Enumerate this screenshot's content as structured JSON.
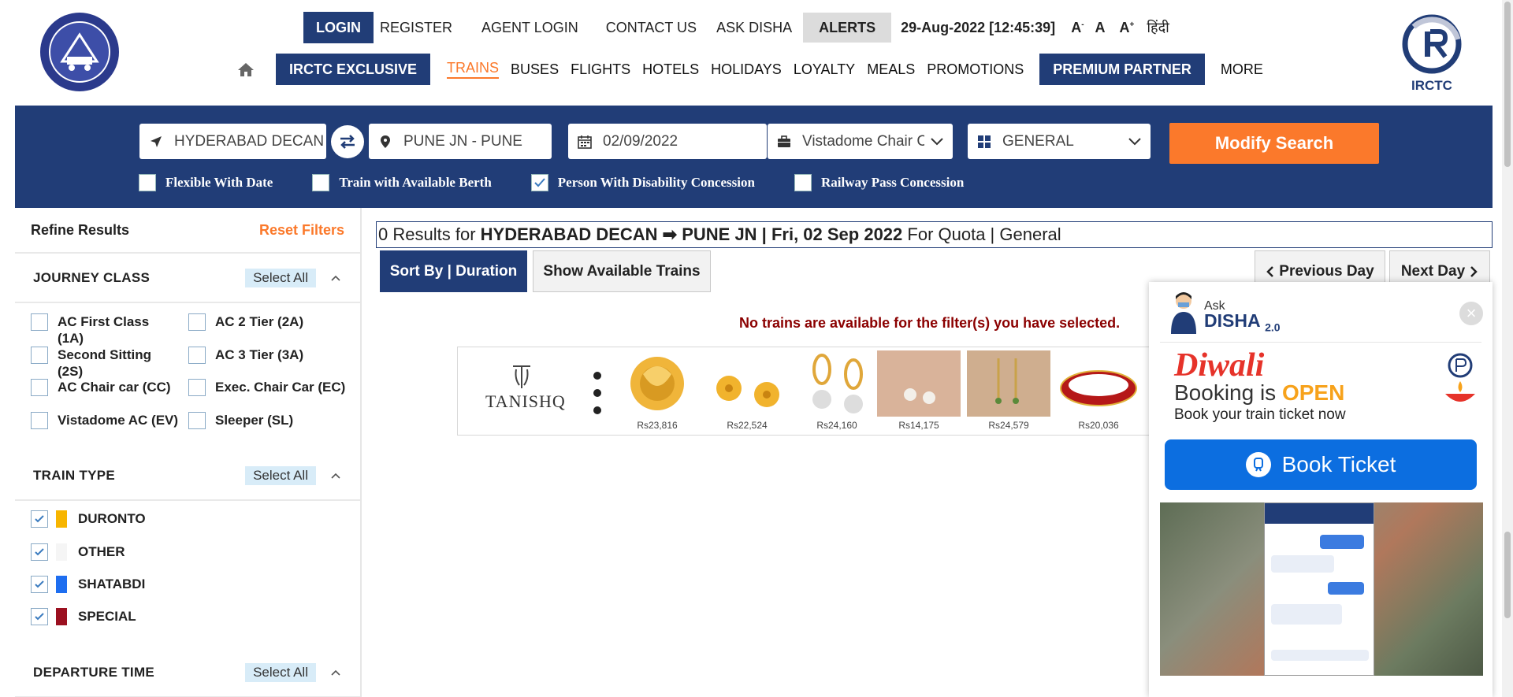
{
  "header": {
    "login": "LOGIN",
    "register": "REGISTER",
    "agent_login": "AGENT LOGIN",
    "contact_us": "CONTACT US",
    "ask_disha": "ASK DISHA",
    "alerts": "ALERTS",
    "datetime": "29-Aug-2022 [12:45:39]",
    "font_small": "A",
    "font_normal": "A",
    "font_large": "A",
    "hindi": "हिंदी",
    "irctc_logo_text": "IRCTC"
  },
  "nav": {
    "exclusive": "IRCTC EXCLUSIVE",
    "items": [
      "TRAINS",
      "BUSES",
      "FLIGHTS",
      "HOTELS",
      "HOLIDAYS",
      "LOYALTY",
      "MEALS",
      "PROMOTIONS"
    ],
    "premium": "PREMIUM PARTNER",
    "more": "MORE"
  },
  "search": {
    "from": "HYDERABAD DECAN",
    "to": "PUNE JN - PUNE",
    "date": "02/09/2022",
    "class": "Vistadome Chair Car",
    "quota": "GENERAL",
    "modify": "Modify Search",
    "flexible": "Flexible With Date",
    "available_berth": "Train with Available Berth",
    "disability": "Person With Disability Concession",
    "railway_pass": "Railway Pass Concession"
  },
  "sidebar": {
    "refine": "Refine Results",
    "reset": "Reset Filters",
    "journey_class": "JOURNEY CLASS",
    "select_all": "Select All",
    "classes": [
      "AC First Class (1A)",
      "AC 2 Tier (2A)",
      "Second Sitting (2S)",
      "AC 3 Tier (3A)",
      "AC Chair car (CC)",
      "Exec. Chair Car (EC)",
      "Vistadome AC (EV)",
      "Sleeper (SL)"
    ],
    "train_type": "TRAIN TYPE",
    "train_types": [
      "DURONTO",
      "OTHER",
      "SHATABDI",
      "SPECIAL"
    ],
    "train_type_colors": [
      "#f7b500",
      "#f5f5f5",
      "#1e6ef0",
      "#9b1020"
    ],
    "departure_time": "DEPARTURE TIME"
  },
  "results": {
    "count": "0",
    "results_for": "Results for",
    "route": "HYDERABAD DECAN ➡ PUNE JN | Fri, 02 Sep 2022",
    "quota": "For Quota | General",
    "sort": "Sort By | Duration",
    "show_available": "Show Available Trains",
    "prev": "Previous Day",
    "next": "Next Day",
    "no_trains": "No trains are available for the filter(s) you have selected."
  },
  "ad": {
    "brand": "TANISHQ",
    "prices": [
      "Rs23,816",
      "Rs22,524",
      "Rs24,160",
      "Rs14,175",
      "Rs24,579",
      "Rs20,036"
    ]
  },
  "disha": {
    "ask": "Ask",
    "name": "DISHA",
    "version": "2.0",
    "diwali": "Diwali",
    "booking_is": "Booking is",
    "open": "OPEN",
    "book_now": "Book your train ticket now",
    "book_ticket": "Book Ticket"
  }
}
